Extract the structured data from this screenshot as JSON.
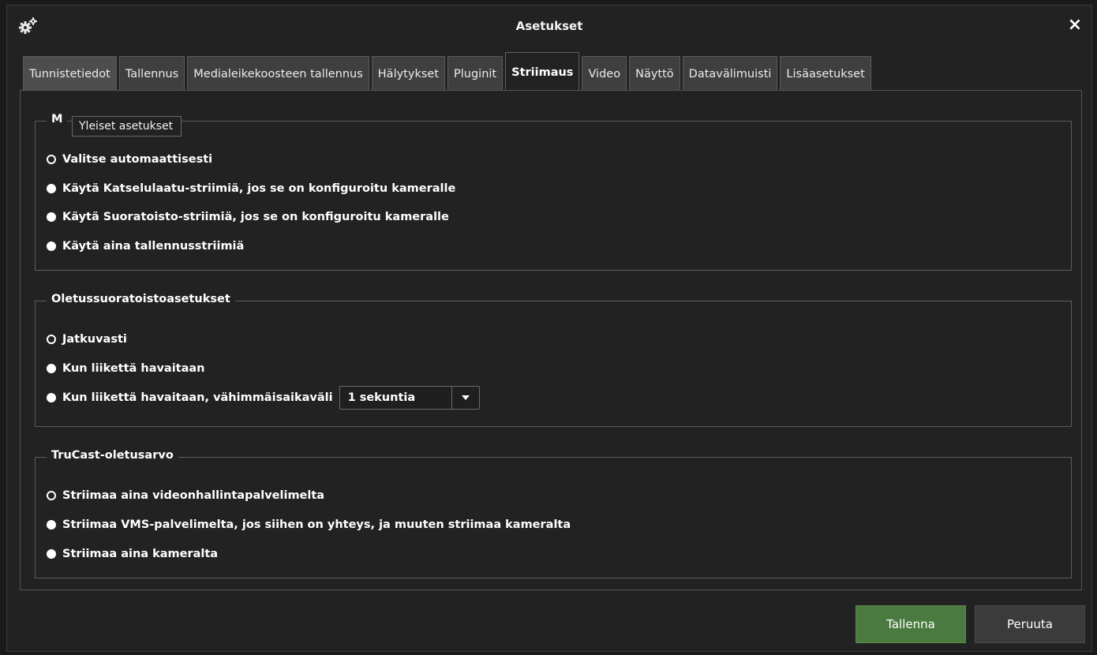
{
  "window": {
    "title": "Asetukset",
    "close_label": "×"
  },
  "tabs": [
    {
      "label": "Tunnistetiedot"
    },
    {
      "label": "Tallennus"
    },
    {
      "label": "Medialeikekoosteen tallennus"
    },
    {
      "label": "Hälytykset"
    },
    {
      "label": "Pluginit"
    },
    {
      "label": "Striimaus"
    },
    {
      "label": "Video"
    },
    {
      "label": "Näyttö"
    },
    {
      "label": "Datavälimuisti"
    },
    {
      "label": "Lisäasetukset"
    }
  ],
  "tooltip": "Yleiset asetukset",
  "groups": [
    {
      "legend": "M",
      "options": [
        {
          "label": "Valitse automaattisesti",
          "selected": true
        },
        {
          "label": "Käytä Katselulaatu-striimiä, jos se on konfiguroitu kameralle",
          "selected": false
        },
        {
          "label": "Käytä Suoratoisto-striimiä, jos se on konfiguroitu kameralle",
          "selected": false
        },
        {
          "label": "Käytä aina tallennusstriimiä",
          "selected": false
        }
      ]
    },
    {
      "legend": "Oletussuoratoistoasetukset",
      "options": [
        {
          "label": "Jatkuvasti",
          "selected": true
        },
        {
          "label": "Kun liikettä havaitaan",
          "selected": false
        },
        {
          "label": "Kun liikettä havaitaan, vähimmäisaikaväli",
          "selected": false
        }
      ],
      "interval_select": {
        "value": "1 sekuntia"
      }
    },
    {
      "legend": "TruCast-oletusarvo",
      "options": [
        {
          "label": "Striimaa aina videonhallintapalvelimelta",
          "selected": true
        },
        {
          "label": "Striimaa VMS-palvelimelta, jos siihen on yhteys, ja muuten striimaa kameralta",
          "selected": false
        },
        {
          "label": "Striimaa aina kameralta",
          "selected": false
        }
      ]
    }
  ],
  "buttons": {
    "save": "Tallenna",
    "cancel": "Peruuta"
  },
  "icons": {
    "settings": "gears-icon",
    "close": "close-icon",
    "dropdown": "chevron-down-icon"
  },
  "colors": {
    "save_button": "#4a7a3f",
    "cancel_button": "#3b3b3b",
    "background": "#222222"
  }
}
